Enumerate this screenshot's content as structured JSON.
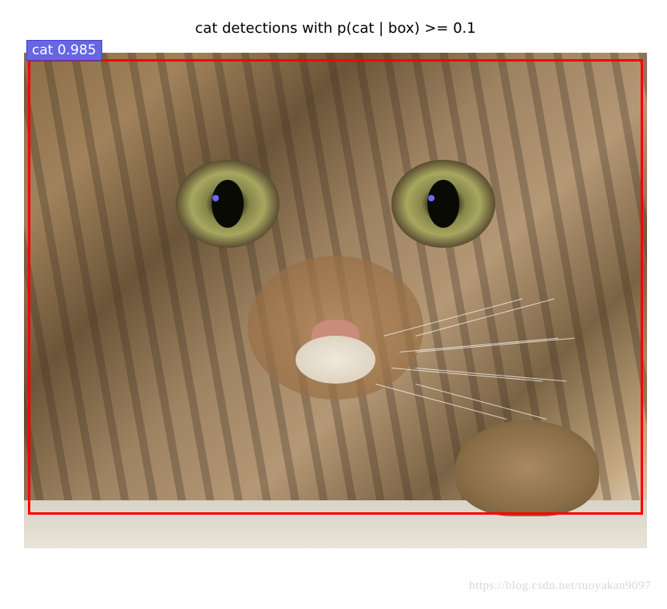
{
  "chart_data": {
    "type": "detection",
    "title": "cat detections with p(cat | box) >= 0.1",
    "detections": [
      {
        "class": "cat",
        "confidence": 0.985,
        "box_color": "#ff0000"
      }
    ]
  },
  "detection": {
    "label": "cat 0.985"
  },
  "watermark": {
    "text": "https://blog.csdn.net/tuoyakan9097"
  }
}
